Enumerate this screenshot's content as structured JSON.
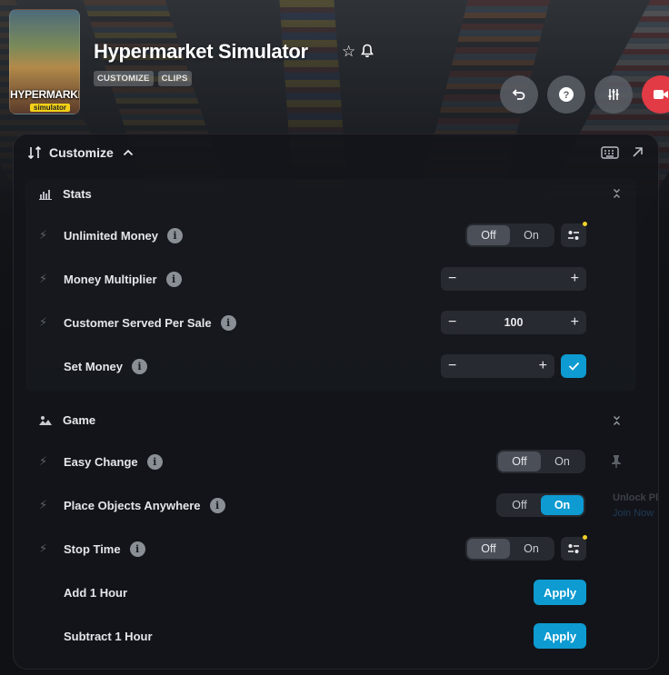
{
  "header": {
    "game_title": "Hypermarket Simulator",
    "cover_title": "HYPERMARKET",
    "cover_subtitle": "simulator",
    "tags": [
      "CUSTOMIZE",
      "CLIPS"
    ],
    "icons": [
      "star-icon",
      "bell-icon"
    ],
    "buttons": [
      "undo-icon",
      "help-icon",
      "sliders-icon",
      "record-icon"
    ]
  },
  "panel": {
    "title": "Customize",
    "header_icons": [
      "keyboard-icon",
      "popout-icon"
    ]
  },
  "sections": {
    "stats": {
      "title": "Stats",
      "rows": {
        "unlimited_money": {
          "label": "Unlimited Money",
          "off": "Off",
          "on": "On",
          "state": "Off"
        },
        "money_multiplier": {
          "label": "Money Multiplier",
          "value": ""
        },
        "customer_served": {
          "label": "Customer Served Per Sale",
          "value": "100"
        },
        "set_money": {
          "label": "Set Money",
          "value": ""
        }
      }
    },
    "game": {
      "title": "Game",
      "rows": {
        "easy_change": {
          "label": "Easy Change",
          "off": "Off",
          "on": "On",
          "state": "Off"
        },
        "place_objects": {
          "label": "Place Objects Anywhere",
          "off": "Off",
          "on": "On",
          "state": "On"
        },
        "stop_time": {
          "label": "Stop Time",
          "off": "Off",
          "on": "On",
          "state": "Off"
        },
        "add_hour": {
          "label": "Add 1 Hour",
          "button": "Apply"
        },
        "subtract_hour": {
          "label": "Subtract 1 Hour",
          "button": "Apply"
        }
      }
    }
  },
  "side": {
    "text1": "Unlock Pl",
    "text2": "Join Now"
  },
  "colors": {
    "accent": "#0d9bd1",
    "record": "#e23b46",
    "dot": "#f3d02a"
  }
}
